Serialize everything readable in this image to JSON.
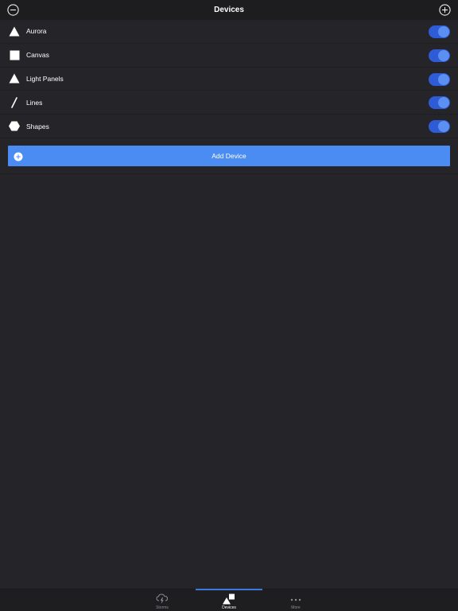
{
  "header": {
    "title": "Devices",
    "left_icon": "minus-circle-icon",
    "right_icon": "plus-circle-icon"
  },
  "devices": [
    {
      "label": "Aurora",
      "icon": "triangle-icon",
      "enabled": true
    },
    {
      "label": "Canvas",
      "icon": "square-icon",
      "enabled": true
    },
    {
      "label": "Light Panels",
      "icon": "triangle-icon",
      "enabled": true
    },
    {
      "label": "Lines",
      "icon": "line-icon",
      "enabled": true
    },
    {
      "label": "Shapes",
      "icon": "hexagon-icon",
      "enabled": true
    }
  ],
  "add_device": {
    "label": "Add Device",
    "icon": "plus-circle-icon"
  },
  "tabs": [
    {
      "label": "Storms",
      "icon": "storm-cloud-icon",
      "active": false
    },
    {
      "label": "Devices",
      "icon": "devices-icon",
      "active": true
    },
    {
      "label": "More",
      "icon": "ellipsis-icon",
      "active": false
    }
  ],
  "colors": {
    "background": "#252529",
    "nav_bar": "#1d1d20",
    "accent": "#4a8cf2",
    "toggle_on": "#2f5bd6"
  }
}
